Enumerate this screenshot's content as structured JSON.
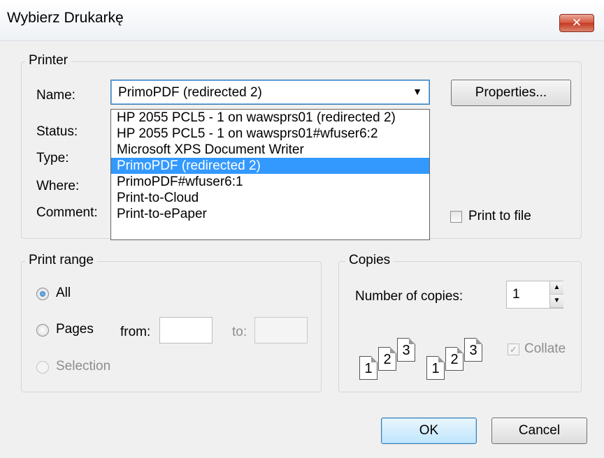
{
  "window": {
    "title": "Wybierz Drukarkę",
    "close_label": "✕"
  },
  "printer": {
    "legend": "Printer",
    "name_label": "Name:",
    "status_label": "Status:",
    "type_label": "Type:",
    "where_label": "Where:",
    "comment_label": "Comment:",
    "selected": "PrimoPDF (redirected 2)",
    "options": [
      "HP 2055 PCL5 - 1 on wawsprs01 (redirected 2)",
      "HP 2055 PCL5 - 1 on wawsprs01#wfuser6:2",
      "Microsoft XPS Document Writer",
      "PrimoPDF (redirected 2)",
      "PrimoPDF#wfuser6:1",
      "Print-to-Cloud",
      "Print-to-ePaper"
    ],
    "selected_index": 3,
    "properties_label": "Properties...",
    "print_to_file_label": "Print to file"
  },
  "print_range": {
    "legend": "Print range",
    "all_label": "All",
    "pages_label": "Pages",
    "from_label": "from:",
    "to_label": "to:",
    "selection_label": "Selection",
    "from_value": "",
    "to_value": ""
  },
  "copies": {
    "legend": "Copies",
    "number_label": "Number of copies:",
    "number_value": "1",
    "collate_label": "Collate",
    "page_numbers": [
      "1",
      "2",
      "3"
    ]
  },
  "footer": {
    "ok_label": "OK",
    "cancel_label": "Cancel"
  },
  "colors": {
    "selection": "#3399ff",
    "dialog_bg": "#f0f0f0"
  }
}
